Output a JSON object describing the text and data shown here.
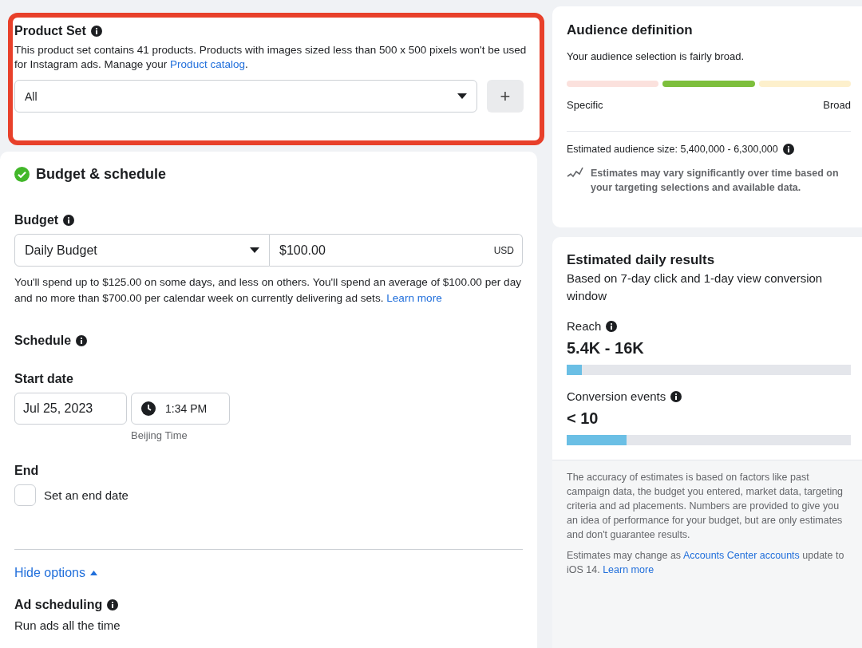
{
  "product_set": {
    "title": "Product Set",
    "description": "This product set contains 41 products. Products with images sized less than 500 x 500 pixels won't be used for Instagram ads. Manage your ",
    "catalog_link": "Product catalog",
    "description_end": ".",
    "dropdown_value": "All",
    "add_button": "+",
    "highlighted": true
  },
  "budget_schedule": {
    "title": "Budget & schedule",
    "complete": true,
    "budget_label": "Budget",
    "budget_type": "Daily Budget",
    "amount": "$100.00",
    "currency": "USD",
    "budget_note": "You'll spend up to $125.00 on some days, and less on others. You'll spend an average of $100.00 per day and no more than $700.00 per calendar week on currently delivering ad sets. ",
    "budget_link": "Learn more",
    "schedule_label": "Schedule",
    "start_date_label": "Start date",
    "start_date": "Jul 25, 2023",
    "start_time": "1:34 PM",
    "timezone": "Beijing Time",
    "end_label": "End",
    "end_checkbox": {
      "label": "Set an end date",
      "checked": false
    },
    "hide_options": "Hide options",
    "ad_scheduling_label": "Ad scheduling",
    "ad_scheduling_value": "Run ads all the time"
  },
  "audience_definition": {
    "title": "Audience definition",
    "summary": "Your audience selection is fairly broad.",
    "segments": [
      {
        "color": "#fbe1dd"
      },
      {
        "color": "#7dbf3c"
      },
      {
        "color": "#fdf0cc"
      }
    ],
    "min_label": "Specific",
    "max_label": "Broad",
    "size": "Estimated audience size: 5,400,000 - 6,300,000",
    "note": "Estimates may vary significantly over time based on your targeting selections and available data."
  },
  "estimated_results": {
    "title": "Estimated daily results",
    "subtitle": "Based on 7-day click and 1-day view conversion window",
    "metrics": [
      {
        "label": "Reach",
        "value": "5.4K - 16K",
        "level": 0.053
      },
      {
        "label": "Conversion events",
        "value": "< 10",
        "level": 0.21
      }
    ],
    "disclaimer": "The accuracy of estimates is based on factors like past campaign data, the budget you entered, market data, targeting criteria and ad placements. Numbers are provided to give you an idea of performance for your budget, but are only estimates and don't guarantee results.",
    "ios_note": "Estimates may change as ",
    "ios_link": "Accounts Center accounts",
    "ios_note_end": " update to iOS 14. ",
    "learn_more": "Learn more"
  }
}
